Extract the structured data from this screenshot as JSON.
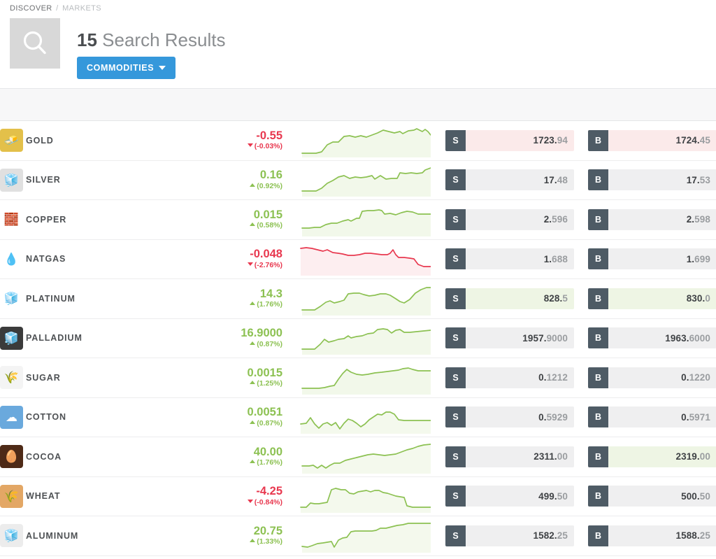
{
  "breadcrumb": {
    "current": "DISCOVER",
    "separator": "/",
    "parent": "MARKETS"
  },
  "header": {
    "search_icon": "search-icon",
    "count": "15",
    "label": "Search Results",
    "filter_label": "COMMODITIES"
  },
  "colors": {
    "accent_blue": "#3598db",
    "up_green": "#8cc152",
    "down_red": "#e8384f",
    "badge_slate": "#4e5b65",
    "price_bg": "#efeff0",
    "hl_red": "#fbeaea",
    "hl_green": "#eef5e4"
  },
  "quote_labels": {
    "sell": "S",
    "buy": "B"
  },
  "rows": [
    {
      "name": "GOLD",
      "icon": "gold-bar-icon",
      "icon_glyph": "🧈",
      "icon_bg": "#e3c04a",
      "icon_fg": "#ffffff",
      "change": "-0.55",
      "percent": "(-0.03%)",
      "dir": "down",
      "sell": {
        "head": "1723.",
        "tail": "94",
        "hl": "red"
      },
      "buy": {
        "head": "1724.",
        "tail": "45",
        "hl": "red"
      },
      "spark": "6,46 20,46 26,46 34,44 42,34 50,30 58,30 66,22 74,21 82,23 90,21 98,23 106,20 114,17 122,13 130,15 138,17 146,15 150,18 158,14 166,13 170,11 178,15 182,12 186,15 190,20 190,20",
      "spark_color": "#8cc152",
      "spark_fill": "#f2f8ea"
    },
    {
      "name": "SILVER",
      "icon": "silver-bar-icon",
      "icon_glyph": "🧊",
      "icon_bg": "#e0e0e0",
      "icon_fg": "#ffffff",
      "change": "0.16",
      "percent": "(0.92%)",
      "dir": "up",
      "sell": {
        "head": "17.",
        "tail": "48",
        "hl": "none"
      },
      "buy": {
        "head": "17.",
        "tail": "53",
        "hl": "none"
      },
      "spark": "6,44 20,44 26,44 34,40 42,33 50,29 58,24 66,22 74,26 82,24 90,25 98,24 106,22 110,27 118,22 126,27 134,26 142,26 146,18 154,19 162,18 170,19 178,18 182,14 190,11 190,11",
      "spark_color": "#8cc152",
      "spark_fill": "#f2f8ea"
    },
    {
      "name": "COPPER",
      "icon": "copper-bar-icon",
      "icon_glyph": "🧱",
      "icon_bg": "transparent",
      "icon_fg": "#b5733a",
      "change": "0.015",
      "percent": "(0.58%)",
      "dir": "up",
      "sell": {
        "head": "2.",
        "tail": "596",
        "hl": "none"
      },
      "buy": {
        "head": "2.",
        "tail": "598",
        "hl": "none"
      },
      "spark": "6,40 16,40 24,39 32,39 40,35 48,33 56,33 64,30 72,28 76,30 84,26 88,26 92,16 100,15 108,15 116,14 120,15 124,20 132,19 140,21 148,18 156,16 164,17 172,20 180,20 190,20",
      "spark_color": "#8cc152",
      "spark_fill": "#f2f8ea"
    },
    {
      "name": "NATGAS",
      "icon": "natgas-flame-icon",
      "icon_glyph": "💧",
      "icon_bg": "transparent",
      "icon_fg": "#5b9bd5",
      "change": "-0.048",
      "percent": "(-2.76%)",
      "dir": "down",
      "sell": {
        "head": "1.",
        "tail": "688",
        "hl": "none"
      },
      "buy": {
        "head": "1.",
        "tail": "699",
        "hl": "none"
      },
      "spark": "4,13 12,12 20,13 28,15 36,17 42,15 50,19 58,20 64,21 72,23 80,23 88,22 96,20 104,20 112,21 120,22 128,22 132,20 136,15 140,22 144,26 152,26 160,27 166,28 172,36 180,39 190,39",
      "spark_color": "#e8384f",
      "spark_fill": "#fdeef0"
    },
    {
      "name": "PLATINUM",
      "icon": "platinum-bar-icon",
      "icon_glyph": "🧊",
      "icon_bg": "transparent",
      "icon_fg": "#b9b9b9",
      "change": "14.3",
      "percent": "(1.76%)",
      "dir": "up",
      "sell": {
        "head": "828.",
        "tail": "5",
        "hl": "green"
      },
      "buy": {
        "head": "830.",
        "tail": "0",
        "hl": "green"
      },
      "spark": "6,44 18,44 24,44 32,39 40,33 46,31 52,34 60,32 66,30 72,21 80,20 88,20 94,22 102,24 110,23 118,21 126,21 132,23 140,28 146,32 152,34 160,29 168,20 176,15 184,12 190,12",
      "spark_color": "#8cc152",
      "spark_fill": "#f2f8ea"
    },
    {
      "name": "PALLADIUM",
      "icon": "palladium-bar-icon",
      "icon_glyph": "🧊",
      "icon_bg": "#3b3b3b",
      "icon_fg": "#d8c9a8",
      "change": "16.9000",
      "percent": "(0.87%)",
      "dir": "up",
      "sell": {
        "head": "1957.",
        "tail": "9000",
        "hl": "none"
      },
      "buy": {
        "head": "1963.",
        "tail": "6000",
        "hl": "none"
      },
      "spark": "6,44 18,44 24,44 32,37 38,30 44,34 52,32 58,30 66,29 72,25 76,28 84,26 92,25 100,22 108,21 114,16 122,15 128,16 134,21 140,17 146,16 152,20 160,20 170,19 180,18 190,17",
      "spark_color": "#8cc152",
      "spark_fill": "#f2f8ea"
    },
    {
      "name": "SUGAR",
      "icon": "sugar-cane-icon",
      "icon_glyph": "🌾",
      "icon_bg": "#f4f4f4",
      "icon_fg": "#a8cf72",
      "change": "0.0015",
      "percent": "(1.25%)",
      "dir": "up",
      "sell": {
        "head": "0.",
        "tail": "1212",
        "hl": "none"
      },
      "buy": {
        "head": "0.",
        "tail": "1220",
        "hl": "none"
      },
      "spark": "6,43 20,43 30,43 38,42 46,40 52,39 58,30 64,22 70,16 76,20 84,23 92,24 100,23 110,21 120,20 128,19 136,18 144,17 150,15 158,14 164,16 172,18 180,18 190,18",
      "spark_color": "#8cc152",
      "spark_fill": "#f2f8ea"
    },
    {
      "name": "COTTON",
      "icon": "cotton-boll-icon",
      "icon_glyph": "☁",
      "icon_bg": "#6aa9dd",
      "icon_fg": "#ffffff",
      "change": "0.0051",
      "percent": "(0.87%)",
      "dir": "up",
      "sell": {
        "head": "0.",
        "tail": "5929",
        "hl": "none"
      },
      "buy": {
        "head": "0.",
        "tail": "5971",
        "hl": "none"
      },
      "spark": "4,38 12,37 18,29 24,38 30,44 36,38 42,36 48,40 54,36 60,45 66,37 72,31 78,33 84,37 90,42 96,38 102,32 108,28 114,24 120,25 126,21 132,21 138,24 144,32 152,33 162,33 172,33 190,33",
      "spark_color": "#8cc152",
      "spark_fill": "#f4f9ed"
    },
    {
      "name": "COCOA",
      "icon": "cocoa-pod-icon",
      "icon_glyph": "🥚",
      "icon_bg": "#4e2a17",
      "icon_fg": "#d7c6ae",
      "change": "40.00",
      "percent": "(1.76%)",
      "dir": "up",
      "sell": {
        "head": "2311.",
        "tail": "00",
        "hl": "none"
      },
      "buy": {
        "head": "2319.",
        "tail": "00",
        "hl": "green"
      },
      "spark": "6,41 16,41 22,40 28,44 34,40 40,44 46,40 52,37 60,37 68,33 76,31 84,29 92,27 100,25 108,24 116,25 124,26 132,25 140,24 148,21 156,18 164,16 172,13 180,11 190,10",
      "spark_color": "#8cc152",
      "spark_fill": "#f4f9ed"
    },
    {
      "name": "WHEAT",
      "icon": "wheat-icon",
      "icon_glyph": "🌾",
      "icon_bg": "#e3a765",
      "icon_fg": "#fff6e6",
      "change": "-4.25",
      "percent": "(-0.84%)",
      "dir": "down",
      "sell": {
        "head": "499.",
        "tail": "50",
        "hl": "none"
      },
      "buy": {
        "head": "500.",
        "tail": "50",
        "hl": "none"
      },
      "spark": "4,44 12,44 18,38 24,39 30,39 36,38 42,37 48,19 54,17 62,19 68,19 74,24 80,25 86,22 92,21 98,20 104,22 110,20 116,20 122,23 128,24 134,26 140,28 146,29 152,30 156,42 164,44 190,44",
      "spark_color": "#8cc152",
      "spark_fill": "#f4f9ed"
    },
    {
      "name": "ALUMINUM",
      "icon": "aluminum-bar-icon",
      "icon_glyph": "🧊",
      "icon_bg": "#ececec",
      "icon_fg": "#b6b6b6",
      "change": "20.75",
      "percent": "(1.33%)",
      "dir": "up",
      "sell": {
        "head": "1582.",
        "tail": "25",
        "hl": "none"
      },
      "buy": {
        "head": "1588.",
        "tail": "25",
        "hl": "none"
      },
      "spark": "6,43 14,44 20,42 28,39 36,38 42,37 48,36 52,44 58,34 64,31 70,30 76,22 82,21 90,21 98,21 106,21 112,20 118,17 126,17 134,15 142,13 150,12 158,10 168,10 180,10 190,10",
      "spark_color": "#8cc152",
      "spark_fill": "#f4f9ed"
    }
  ]
}
